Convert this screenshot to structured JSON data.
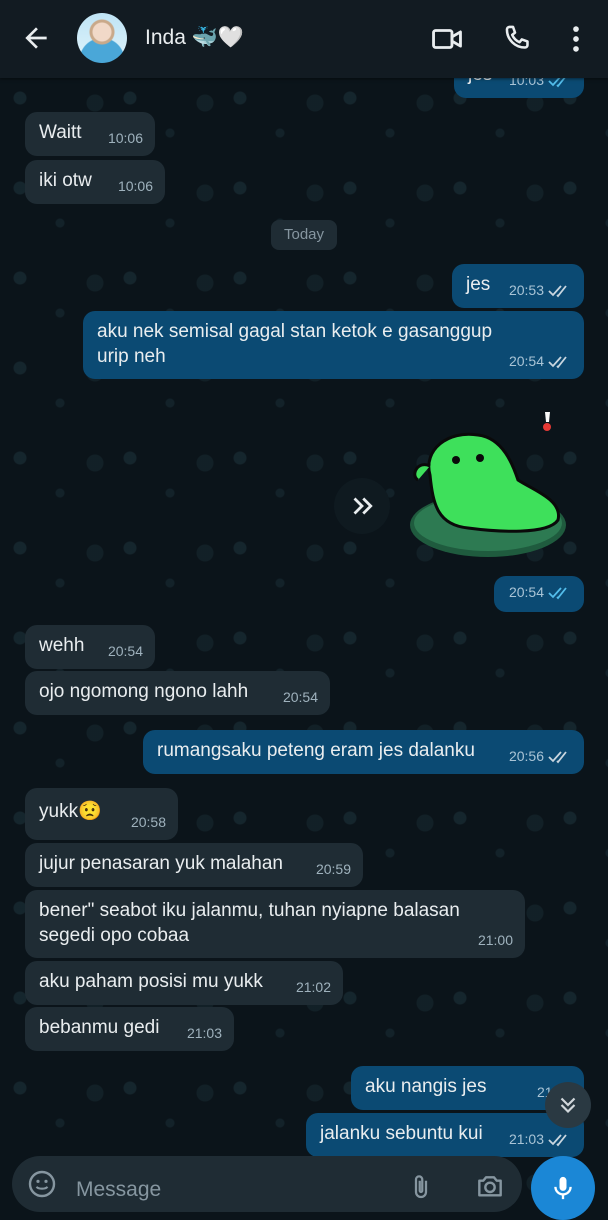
{
  "header": {
    "contact_name": "Inda 🐳🤍"
  },
  "day_chip": "Today",
  "messages": [
    {
      "dir": "out",
      "text": "jes",
      "time": "10:03"
    },
    {
      "dir": "in",
      "text": "Waitt",
      "time": "10:06"
    },
    {
      "dir": "in",
      "text": "iki otw",
      "time": "10:06"
    },
    {
      "dir": "out",
      "text": "jes",
      "time": "20:53"
    },
    {
      "dir": "out",
      "text": "aku nek semisal gagal stan ketok e gasanggup urip neh",
      "time": "20:54"
    },
    {
      "dir": "out",
      "text": "",
      "time": "20:54"
    },
    {
      "dir": "in",
      "text": "wehh",
      "time": "20:54"
    },
    {
      "dir": "in",
      "text": "ojo ngomong ngono lahh",
      "time": "20:54"
    },
    {
      "dir": "out",
      "text": "rumangsaku peteng eram jes dalanku",
      "time": "20:56"
    },
    {
      "dir": "in",
      "text": "yukk😟",
      "time": "20:58"
    },
    {
      "dir": "in",
      "text": "jujur penasaran yuk malahan",
      "time": "20:59"
    },
    {
      "dir": "in",
      "text": "bener\" seabot iku jalanmu, tuhan nyiapne balasan segedi opo cobaa",
      "time": "21:00"
    },
    {
      "dir": "in",
      "text": "aku paham posisi mu yukk",
      "time": "21:02"
    },
    {
      "dir": "in",
      "text": "bebanmu gedi",
      "time": "21:03"
    },
    {
      "dir": "out",
      "text": "aku nangis jes",
      "time": "21:03"
    },
    {
      "dir": "out",
      "text": "jalanku sebuntu kui",
      "time": "21:03"
    }
  ],
  "composer": {
    "placeholder": "Message"
  },
  "colors": {
    "incoming_bubble": "#1f2c34",
    "outgoing_bubble": "#0b4a73",
    "accent": "#1b87d6",
    "read_ticks": "#53bdeb"
  }
}
